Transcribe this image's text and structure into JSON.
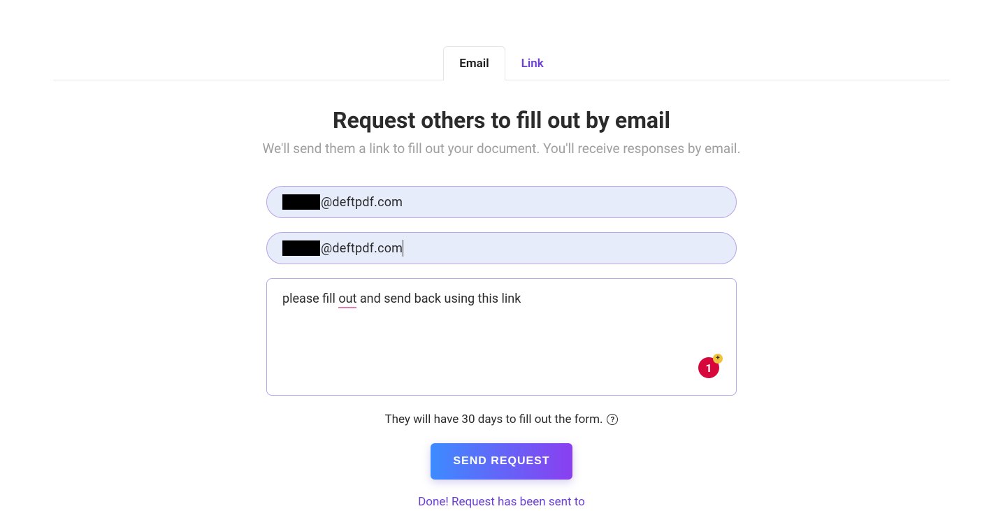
{
  "tabs": {
    "email": "Email",
    "link": "Link"
  },
  "header": {
    "title": "Request others to fill out by email",
    "subtitle": "We'll send them a link to fill out your document. You'll receive responses by email."
  },
  "form": {
    "email1_suffix": "@deftpdf.com",
    "email2_suffix": "@deftpdf.com",
    "message_pre": "please fill ",
    "message_underlined": "out",
    "message_post": " and send back using this link",
    "badge_count": "1",
    "badge_plus": "+"
  },
  "note": {
    "text": "They will have 30 days to fill out the form.",
    "help_glyph": "?"
  },
  "actions": {
    "send_label": "SEND REQUEST"
  },
  "status": {
    "done_message": "Done! Request has been sent to"
  }
}
